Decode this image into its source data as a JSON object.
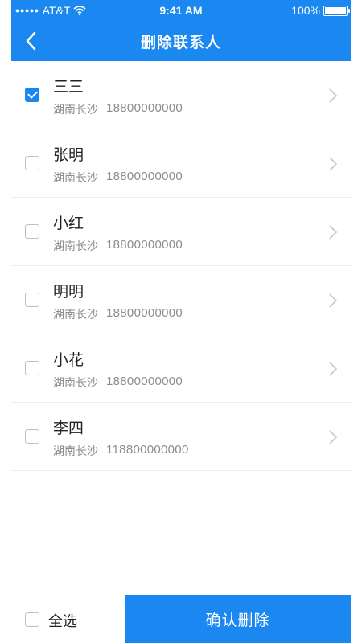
{
  "status_bar": {
    "signal_dots": "●●●●●",
    "carrier": "AT&T",
    "time": "9:41 AM",
    "battery": "100%"
  },
  "header": {
    "title": "删除联系人",
    "back_icon": "chevron-left-icon"
  },
  "contacts": [
    {
      "name": "三三",
      "location": "湖南长沙",
      "phone": "18800000000",
      "checked": true
    },
    {
      "name": "张明",
      "location": "湖南长沙",
      "phone": "18800000000",
      "checked": false
    },
    {
      "name": "小红",
      "location": "湖南长沙",
      "phone": "18800000000",
      "checked": false
    },
    {
      "name": "明明",
      "location": "湖南长沙",
      "phone": "18800000000",
      "checked": false
    },
    {
      "name": "小花",
      "location": "湖南长沙",
      "phone": "18800000000",
      "checked": false
    },
    {
      "name": "李四",
      "location": "湖南长沙",
      "phone": "118800000000",
      "checked": false
    }
  ],
  "footer": {
    "select_all_label": "全选",
    "select_all_checked": false,
    "confirm_label": "确认删除"
  },
  "colors": {
    "accent": "#1a88f0",
    "divider": "#ededed",
    "secondary_text": "#8c8c8c"
  }
}
